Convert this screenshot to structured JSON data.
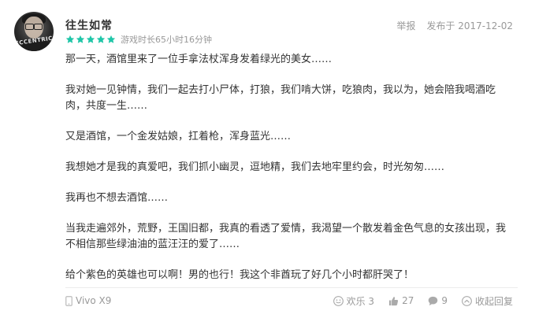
{
  "review": {
    "username": "往生如常",
    "rating": 5,
    "rating_max": 5,
    "playtime": "游戏时长65小时16分钟",
    "report_label": "举报",
    "published": "发布于 2017-12-02",
    "avatar_text": "ECCENTRIC",
    "paragraphs": [
      "那一天，酒馆里来了一位手拿法杖浑身发着绿光的美女……",
      "我对她一见钟情，我们一起去打小尸体，打狼，我们啃大饼，吃狼肉，我以为，她会陪我喝酒吃肉，共度一生……",
      "又是酒馆，一个金发姑娘，扛着枪，浑身蓝光……",
      "我想她才是我的真爱吧，我们抓小幽灵，逗地精，我们去地牢里约会，时光匆匆……",
      "我再也不想去酒馆……",
      "当我走遍郊外，荒野，王国旧都，我真的看透了爱情，我渴望一个散发着金色气息的女孩出现，我不相信那些绿油油的蓝汪汪的爱了……",
      "给个紫色的英雄也可以啊！男的也行！我这个非酋玩了好几个小时都肝哭了！"
    ],
    "device": "Vivo X9",
    "reactions": {
      "happy_label": "欢乐 3",
      "likes": "27",
      "comments": "9",
      "collapse_label": "收起回复"
    }
  },
  "colors": {
    "star": "#1fc6a8",
    "text": "#333333",
    "muted": "#999999",
    "divider": "#ececec"
  },
  "icons": {
    "star": "star-icon",
    "phone": "phone-icon",
    "smile": "smile-icon",
    "thumbs_up": "thumbs-up-icon",
    "comment": "comment-icon",
    "collapse": "collapse-icon"
  }
}
